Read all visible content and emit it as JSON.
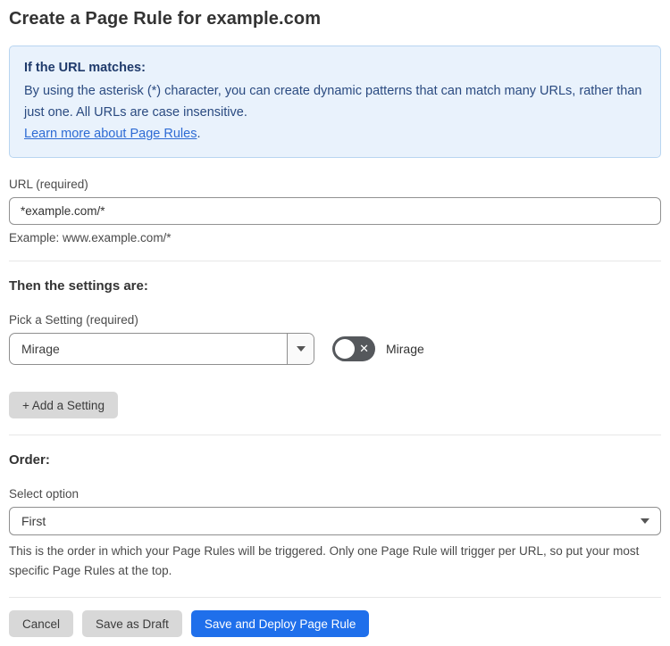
{
  "page": {
    "title": "Create a Page Rule for example.com"
  },
  "info_box": {
    "heading": "If the URL matches:",
    "body": "By using the asterisk (*) character, you can create dynamic patterns that can match many URLs, rather than just one. All URLs are case insensitive.",
    "link_label": "Learn more about Page Rules",
    "link_suffix": "."
  },
  "url_field": {
    "label": "URL (required)",
    "value": "*example.com/*",
    "hint": "Example: www.example.com/*"
  },
  "settings_section": {
    "heading": "Then the settings are:",
    "picker_label": "Pick a Setting (required)",
    "picker_value": "Mirage",
    "toggle": {
      "state": "off",
      "label": "Mirage"
    },
    "add_button_label": "+ Add a Setting"
  },
  "order_section": {
    "heading": "Order:",
    "select_label": "Select option",
    "select_value": "First",
    "help_text": "This is the order in which your Page Rules will be triggered. Only one Page Rule will trigger per URL, so put your most specific Page Rules at the top."
  },
  "footer": {
    "cancel_label": "Cancel",
    "save_draft_label": "Save as Draft",
    "save_deploy_label": "Save and Deploy Page Rule"
  },
  "icons": {
    "toggle_off_glyph": "✕"
  },
  "colors": {
    "primary_blue": "#1f6feb",
    "info_background": "#e9f2fc",
    "info_border": "#b9d5f1",
    "info_text": "#2a4a80",
    "link_blue": "#2e6bd4",
    "toggle_off_gray": "#55585c",
    "button_gray": "#d8d8d8"
  }
}
